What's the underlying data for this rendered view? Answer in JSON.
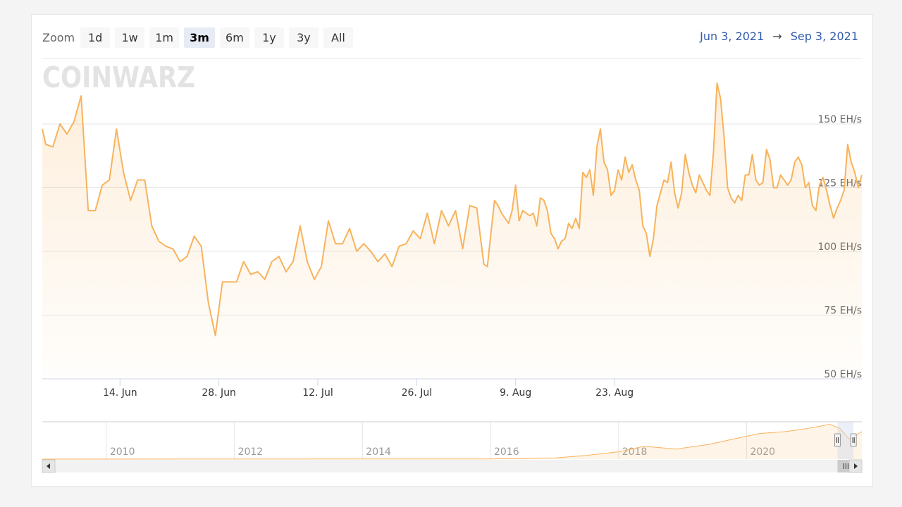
{
  "zoom": {
    "label": "Zoom",
    "buttons": [
      "1d",
      "1w",
      "1m",
      "3m",
      "6m",
      "1y",
      "3y",
      "All"
    ],
    "selected": "3m"
  },
  "range": {
    "from": "Jun 3, 2021",
    "arrow": "→",
    "to": "Sep 3, 2021"
  },
  "watermark": "COINWARZ",
  "colors": {
    "series": "#f7b35c",
    "grid": "#e6e6e6",
    "axis": "#ccd6eb",
    "label": "#666666",
    "date_text": "#335cad",
    "navigator_mask": "#ccd6eb"
  },
  "chart_data": {
    "type": "area",
    "title": "",
    "ylabel": "",
    "y_unit": "EH/s",
    "ylim": [
      50,
      160
    ],
    "y_ticks": [
      "50 EH/s",
      "75 EH/s",
      "100 EH/s",
      "125 EH/s",
      "150 EH/s"
    ],
    "x_ticks": [
      "14. Jun",
      "28. Jun",
      "12. Jul",
      "26. Jul",
      "9. Aug",
      "23. Aug"
    ],
    "x_range": [
      "2021-06-03",
      "2021-09-03"
    ],
    "series": [
      {
        "values": [
          [
            0,
            148
          ],
          [
            0.5,
            142
          ],
          [
            1.5,
            141
          ],
          [
            2.5,
            150
          ],
          [
            3.5,
            146
          ],
          [
            4.5,
            151
          ],
          [
            5.5,
            161
          ],
          [
            6.5,
            116
          ],
          [
            7.5,
            116
          ],
          [
            8.5,
            126
          ],
          [
            9.5,
            128
          ],
          [
            10.5,
            148
          ],
          [
            11.5,
            131
          ],
          [
            12.5,
            120
          ],
          [
            13.5,
            128
          ],
          [
            14.5,
            128
          ],
          [
            15.5,
            110
          ],
          [
            16.5,
            104
          ],
          [
            17.5,
            102
          ],
          [
            18.5,
            101
          ],
          [
            19.5,
            96
          ],
          [
            20.5,
            98
          ],
          [
            21.5,
            106
          ],
          [
            22.5,
            102
          ],
          [
            23.5,
            80
          ],
          [
            24.5,
            67
          ],
          [
            25.5,
            88
          ],
          [
            26.5,
            88
          ],
          [
            27.5,
            88
          ],
          [
            28.5,
            96
          ],
          [
            29.5,
            91
          ],
          [
            30.5,
            92
          ],
          [
            31.5,
            89
          ],
          [
            32.5,
            96
          ],
          [
            33.5,
            98
          ],
          [
            34.5,
            92
          ],
          [
            35.5,
            96
          ],
          [
            36.5,
            110
          ],
          [
            37.5,
            96
          ],
          [
            38.5,
            89
          ],
          [
            39.5,
            94
          ],
          [
            40.5,
            112
          ],
          [
            41.5,
            103
          ],
          [
            42.5,
            103
          ],
          [
            43.5,
            109
          ],
          [
            44.5,
            100
          ],
          [
            45.5,
            103
          ],
          [
            46.5,
            100
          ],
          [
            47.5,
            96
          ],
          [
            48.5,
            99
          ],
          [
            49.5,
            94
          ],
          [
            50.5,
            102
          ],
          [
            51.5,
            103
          ],
          [
            52.5,
            108
          ],
          [
            53.5,
            105
          ],
          [
            54.5,
            115
          ],
          [
            55.5,
            103
          ],
          [
            56.5,
            116
          ],
          [
            57.5,
            110
          ],
          [
            58.5,
            116
          ],
          [
            59.5,
            101
          ],
          [
            60.5,
            118
          ],
          [
            61.5,
            117
          ],
          [
            62.5,
            95
          ],
          [
            63,
            94
          ],
          [
            63.5,
            107
          ],
          [
            64,
            120
          ],
          [
            64.5,
            118
          ],
          [
            65,
            115
          ],
          [
            65.5,
            113
          ],
          [
            66,
            111
          ],
          [
            66.5,
            116
          ],
          [
            67,
            126
          ],
          [
            67.5,
            112
          ],
          [
            68,
            116
          ],
          [
            68.5,
            115
          ],
          [
            69,
            114
          ],
          [
            69.5,
            115
          ],
          [
            70,
            110
          ],
          [
            70.5,
            121
          ],
          [
            71,
            120
          ],
          [
            71.5,
            116
          ],
          [
            72,
            107
          ],
          [
            72.5,
            105
          ],
          [
            73,
            101
          ],
          [
            73.5,
            104
          ],
          [
            74,
            105
          ],
          [
            74.5,
            111
          ],
          [
            75,
            109
          ],
          [
            75.5,
            113
          ],
          [
            76,
            109
          ],
          [
            76.5,
            131
          ],
          [
            77,
            129
          ],
          [
            77.5,
            132
          ],
          [
            78,
            122
          ],
          [
            78.5,
            141
          ],
          [
            79,
            148
          ],
          [
            79.5,
            135
          ],
          [
            80,
            132
          ],
          [
            80.5,
            122
          ],
          [
            81,
            124
          ],
          [
            81.5,
            132
          ],
          [
            82,
            128
          ],
          [
            82.5,
            137
          ],
          [
            83,
            131
          ],
          [
            83.5,
            134
          ],
          [
            84,
            128
          ],
          [
            84.5,
            124
          ],
          [
            85,
            110
          ],
          [
            85.5,
            107
          ],
          [
            86,
            98
          ],
          [
            86.5,
            105
          ],
          [
            87,
            118
          ],
          [
            87.5,
            123
          ],
          [
            88,
            128
          ],
          [
            88.5,
            127
          ],
          [
            89,
            135
          ],
          [
            89.5,
            123
          ],
          [
            90,
            117
          ],
          [
            90.5,
            123
          ],
          [
            91,
            138
          ],
          [
            91.5,
            131
          ],
          [
            92,
            126
          ],
          [
            92.5,
            123
          ],
          [
            93,
            130
          ],
          [
            93.5,
            127
          ],
          [
            94,
            124
          ],
          [
            94.5,
            122
          ],
          [
            95,
            139
          ],
          [
            95.5,
            166
          ],
          [
            96,
            160
          ],
          [
            96.5,
            145
          ],
          [
            97,
            125
          ],
          [
            97.5,
            121
          ],
          [
            98,
            119
          ],
          [
            98.5,
            122
          ],
          [
            99,
            120
          ],
          [
            99.5,
            130
          ],
          [
            100,
            130
          ],
          [
            100.5,
            138
          ],
          [
            101,
            128
          ],
          [
            101.5,
            126
          ],
          [
            102,
            127
          ],
          [
            102.5,
            140
          ],
          [
            103,
            136
          ],
          [
            103.5,
            125
          ],
          [
            104,
            125
          ],
          [
            104.5,
            130
          ],
          [
            105,
            128
          ],
          [
            105.5,
            126
          ],
          [
            106,
            128
          ],
          [
            106.5,
            135
          ],
          [
            107,
            137
          ],
          [
            107.5,
            134
          ],
          [
            108,
            125
          ],
          [
            108.5,
            127
          ],
          [
            109,
            118
          ],
          [
            109.5,
            116
          ],
          [
            110,
            126
          ],
          [
            110.5,
            129
          ],
          [
            111,
            124
          ],
          [
            111.5,
            118
          ],
          [
            112,
            113
          ],
          [
            112.5,
            117
          ],
          [
            113,
            120
          ],
          [
            113.5,
            124
          ],
          [
            114,
            142
          ],
          [
            114.5,
            135
          ],
          [
            115,
            131
          ],
          [
            115.5,
            125
          ],
          [
            116,
            130
          ]
        ]
      }
    ],
    "navigator": {
      "x_ticks": [
        "2010",
        "2012",
        "2014",
        "2016",
        "2018",
        "2020"
      ],
      "series": [
        [
          2009.0,
          0
        ],
        [
          2016.0,
          1
        ],
        [
          2017.0,
          6
        ],
        [
          2017.5,
          20
        ],
        [
          2018.0,
          40
        ],
        [
          2018.4,
          70
        ],
        [
          2018.9,
          55
        ],
        [
          2019.4,
          80
        ],
        [
          2019.8,
          110
        ],
        [
          2020.2,
          140
        ],
        [
          2020.6,
          150
        ],
        [
          2021.0,
          170
        ],
        [
          2021.3,
          190
        ],
        [
          2021.45,
          170
        ],
        [
          2021.6,
          110
        ],
        [
          2021.8,
          150
        ]
      ],
      "xlim": [
        2009.0,
        2021.8
      ],
      "ylim": [
        0,
        200
      ],
      "selection": [
        2021.42,
        2021.67
      ]
    }
  }
}
